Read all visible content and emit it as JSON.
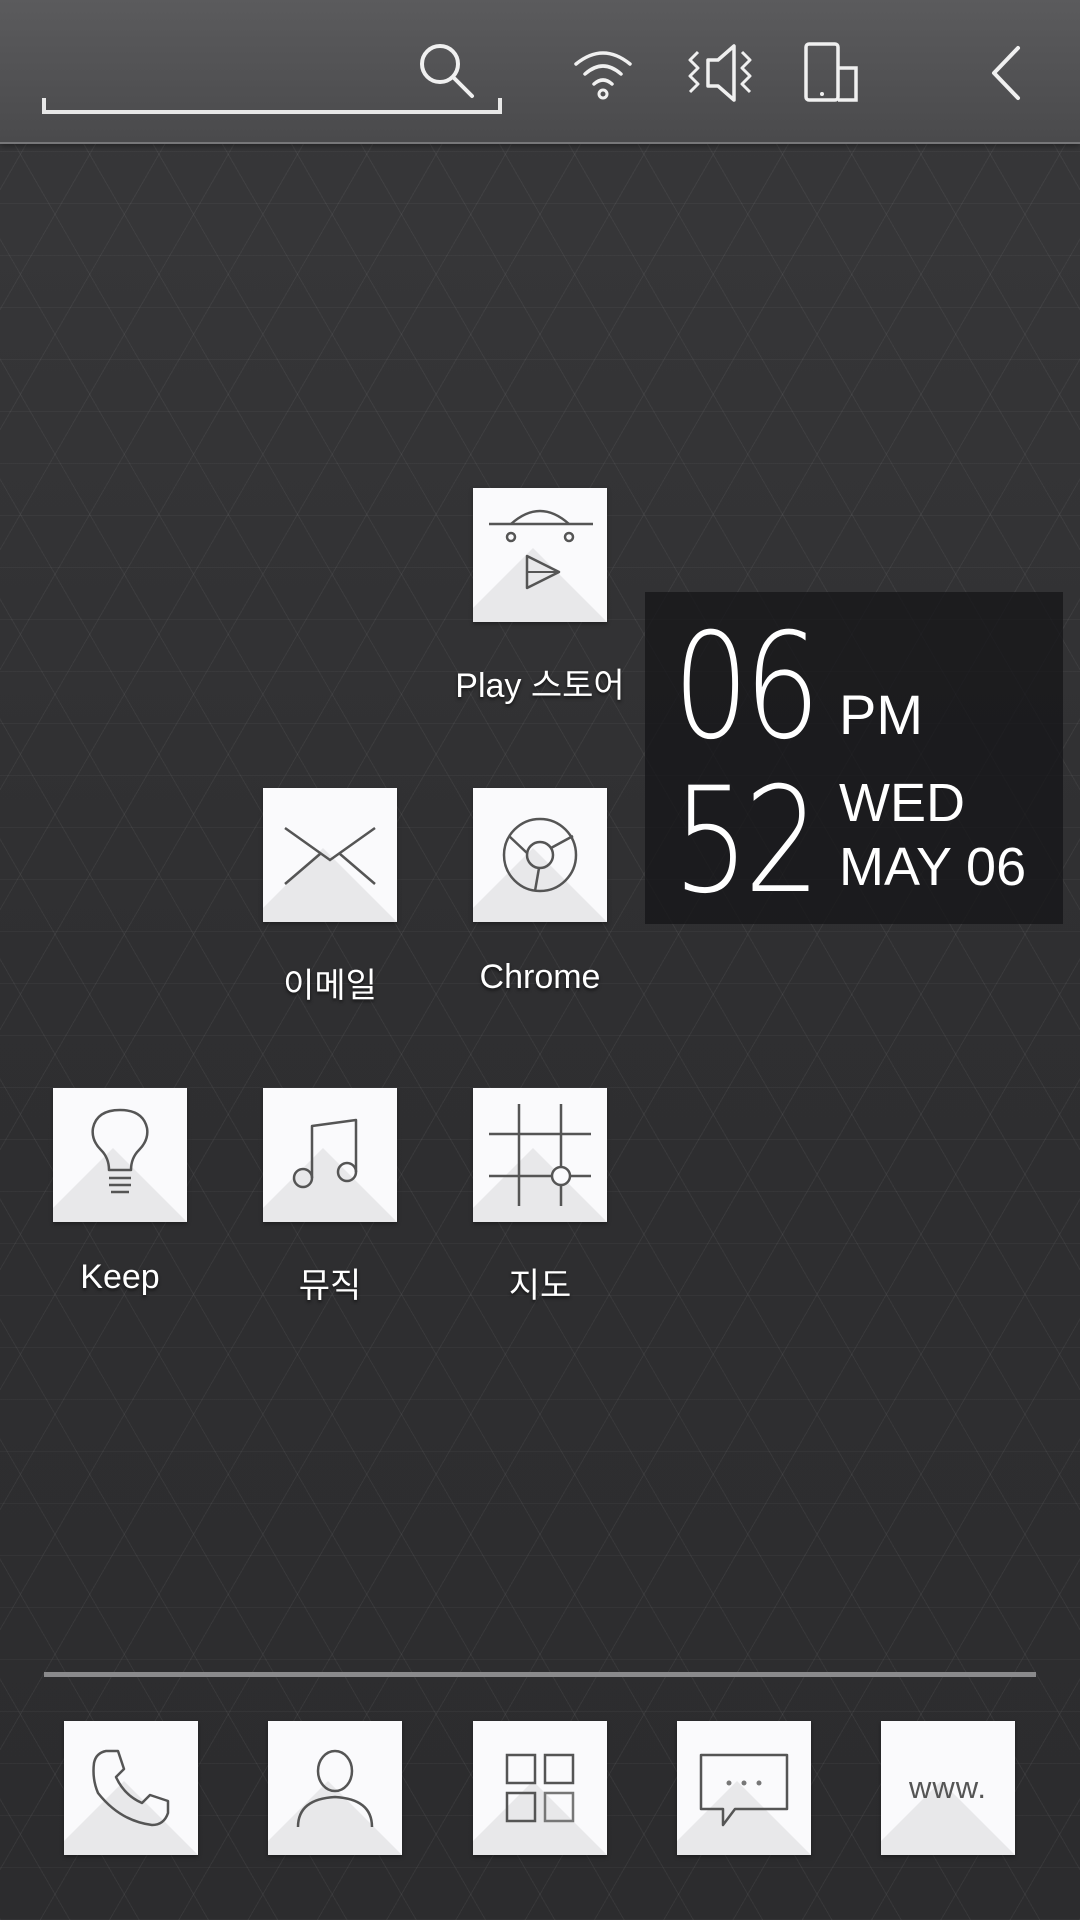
{
  "top_bar": {
    "search_placeholder": "",
    "icons": [
      "search-icon",
      "wifi-icon",
      "vibrate-icon",
      "screen-rotation-icon",
      "back-chevron-icon"
    ]
  },
  "apps": {
    "play_store": {
      "label": "Play 스토어",
      "icon": "play-store-icon"
    },
    "email": {
      "label": "이메일",
      "icon": "envelope-icon"
    },
    "chrome": {
      "label": "Chrome",
      "icon": "chrome-icon"
    },
    "keep": {
      "label": "Keep",
      "icon": "lightbulb-icon"
    },
    "music": {
      "label": "뮤직",
      "icon": "music-note-icon"
    },
    "maps": {
      "label": "지도",
      "icon": "map-icon"
    }
  },
  "clock": {
    "hour": "06",
    "minute": "52",
    "ampm": "PM",
    "day": "WED",
    "date": "MAY 06"
  },
  "dock": {
    "icons": [
      "phone-icon",
      "contacts-icon",
      "app-drawer-icon",
      "messages-icon",
      "browser-icon"
    ],
    "browser_text": "www."
  },
  "colors": {
    "background": "#303031",
    "top_bar": "#505052",
    "tile": "#fafafc",
    "icon_stroke": "#555555",
    "text": "#ffffff"
  }
}
